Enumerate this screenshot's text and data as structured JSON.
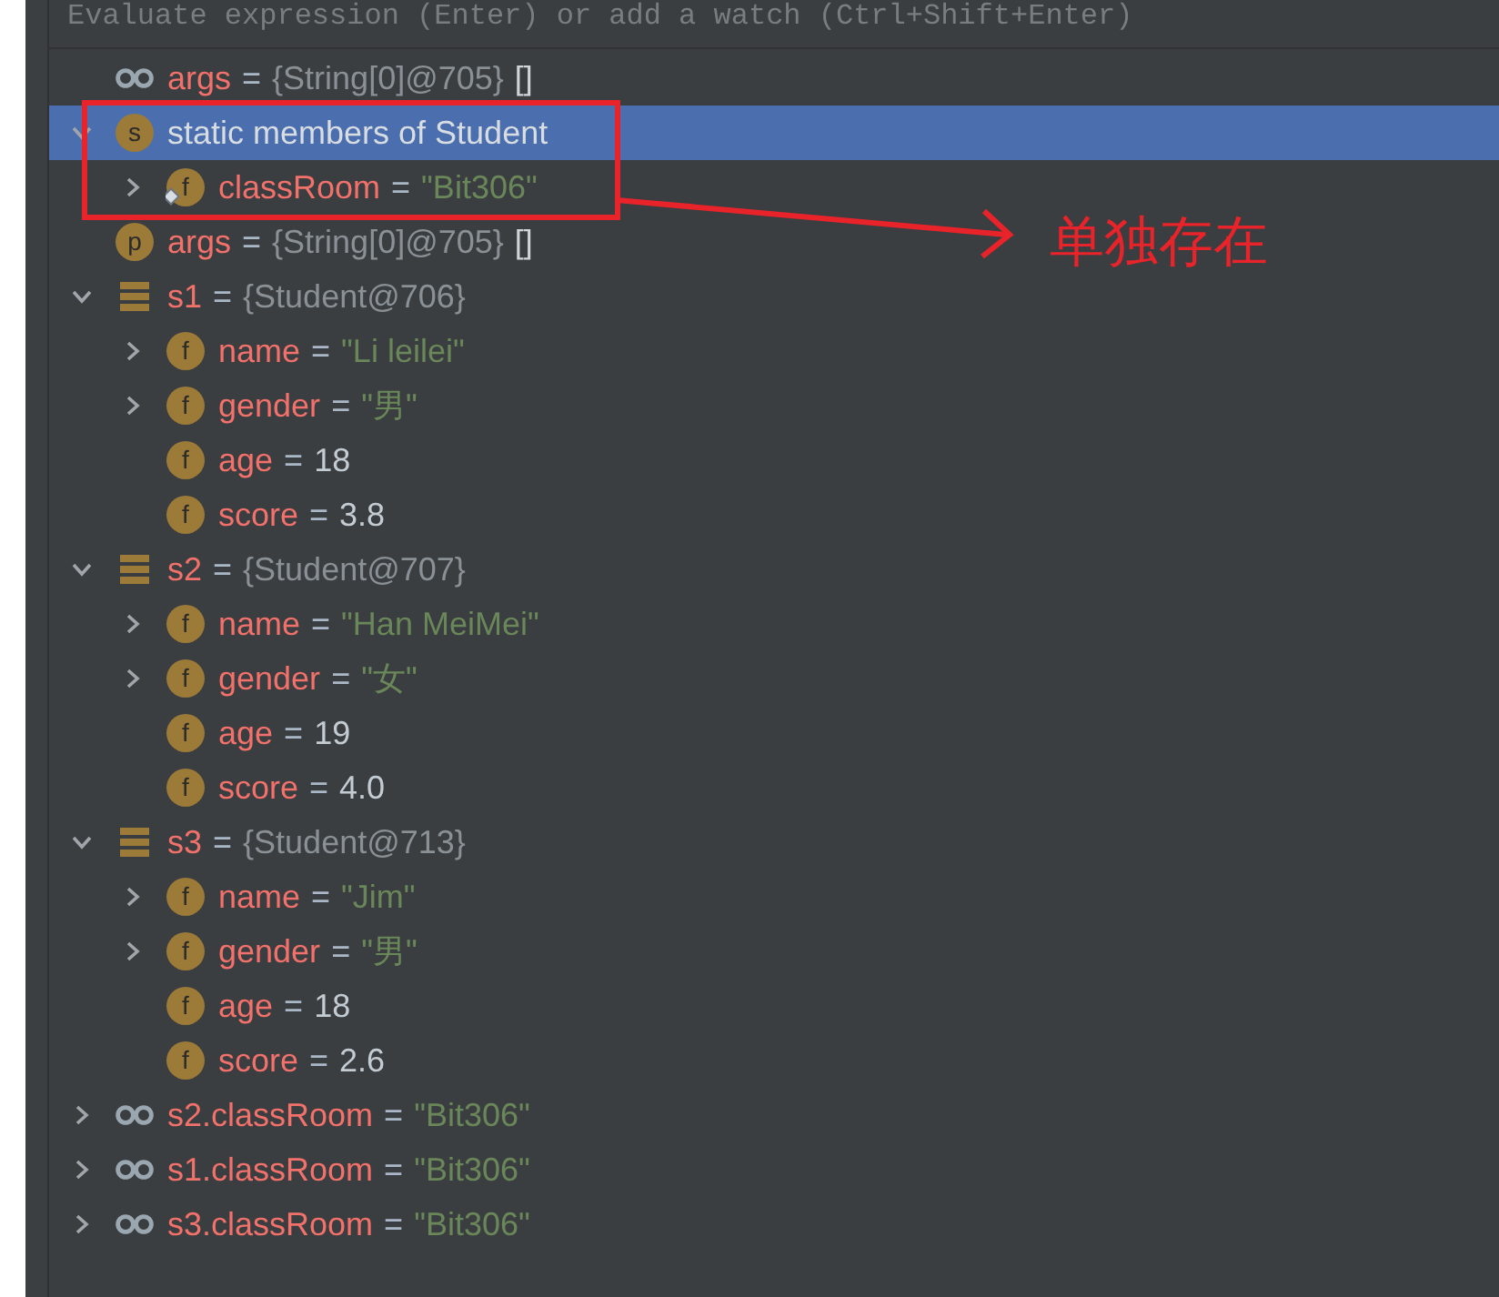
{
  "evaluate_bar": {
    "placeholder": "Evaluate expression (Enter) or add a watch (Ctrl+Shift+Enter)"
  },
  "variables": [
    {
      "kind": "watch",
      "name": "args",
      "op": "=",
      "value": {
        "kind": "ref",
        "text": "{String[0]@705}"
      },
      "extra": "[]",
      "selected": false
    },
    {
      "kind": "static",
      "badge": "s",
      "label": "static members of Student",
      "expanded": true,
      "selected": true,
      "children": [
        {
          "kind": "static_field",
          "badge": "f",
          "name": "classRoom",
          "op": "=",
          "value": {
            "kind": "string",
            "text": "\"Bit306\""
          },
          "expanded": false,
          "selected": false
        }
      ]
    },
    {
      "kind": "param",
      "badge": "p",
      "name": "args",
      "op": "=",
      "value": {
        "kind": "ref",
        "text": "{String[0]@705}"
      },
      "extra": "[]",
      "selected": false
    },
    {
      "kind": "object",
      "name": "s1",
      "op": "=",
      "value": {
        "kind": "ref",
        "text": "{Student@706}"
      },
      "expanded": true,
      "selected": false,
      "children": [
        {
          "kind": "field",
          "badge": "f",
          "name": "name",
          "op": "=",
          "value": {
            "kind": "string",
            "text": "\"Li leilei\""
          },
          "expanded": false,
          "selected": false
        },
        {
          "kind": "field",
          "badge": "f",
          "name": "gender",
          "op": "=",
          "value": {
            "kind": "string",
            "text": "\"男\""
          },
          "expanded": false,
          "selected": false
        },
        {
          "kind": "field",
          "badge": "f",
          "name": "age",
          "op": "=",
          "value": {
            "kind": "number",
            "text": "18"
          },
          "selected": false
        },
        {
          "kind": "field",
          "badge": "f",
          "name": "score",
          "op": "=",
          "value": {
            "kind": "number",
            "text": "3.8"
          },
          "selected": false
        }
      ]
    },
    {
      "kind": "object",
      "name": "s2",
      "op": "=",
      "value": {
        "kind": "ref",
        "text": "{Student@707}"
      },
      "expanded": true,
      "selected": false,
      "children": [
        {
          "kind": "field",
          "badge": "f",
          "name": "name",
          "op": "=",
          "value": {
            "kind": "string",
            "text": "\"Han MeiMei\""
          },
          "expanded": false,
          "selected": false
        },
        {
          "kind": "field",
          "badge": "f",
          "name": "gender",
          "op": "=",
          "value": {
            "kind": "string",
            "text": "\"女\""
          },
          "expanded": false,
          "selected": false
        },
        {
          "kind": "field",
          "badge": "f",
          "name": "age",
          "op": "=",
          "value": {
            "kind": "number",
            "text": "19"
          },
          "selected": false
        },
        {
          "kind": "field",
          "badge": "f",
          "name": "score",
          "op": "=",
          "value": {
            "kind": "number",
            "text": "4.0"
          },
          "selected": false
        }
      ]
    },
    {
      "kind": "object",
      "name": "s3",
      "op": "=",
      "value": {
        "kind": "ref",
        "text": "{Student@713}"
      },
      "expanded": true,
      "selected": false,
      "children": [
        {
          "kind": "field",
          "badge": "f",
          "name": "name",
          "op": "=",
          "value": {
            "kind": "string",
            "text": "\"Jim\""
          },
          "expanded": false,
          "selected": false
        },
        {
          "kind": "field",
          "badge": "f",
          "name": "gender",
          "op": "=",
          "value": {
            "kind": "string",
            "text": "\"男\""
          },
          "expanded": false,
          "selected": false
        },
        {
          "kind": "field",
          "badge": "f",
          "name": "age",
          "op": "=",
          "value": {
            "kind": "number",
            "text": "18"
          },
          "selected": false
        },
        {
          "kind": "field",
          "badge": "f",
          "name": "score",
          "op": "=",
          "value": {
            "kind": "number",
            "text": "2.6"
          },
          "selected": false
        }
      ]
    },
    {
      "kind": "watch",
      "name": "s2.classRoom",
      "op": "=",
      "value": {
        "kind": "string",
        "text": "\"Bit306\""
      },
      "expanded": false,
      "selected": false
    },
    {
      "kind": "watch",
      "name": "s1.classRoom",
      "op": "=",
      "value": {
        "kind": "string",
        "text": "\"Bit306\""
      },
      "expanded": false,
      "selected": false
    },
    {
      "kind": "watch",
      "name": "s3.classRoom",
      "op": "=",
      "value": {
        "kind": "string",
        "text": "\"Bit306\""
      },
      "expanded": false,
      "selected": false
    }
  ],
  "annotation": {
    "text": "单独存在"
  }
}
